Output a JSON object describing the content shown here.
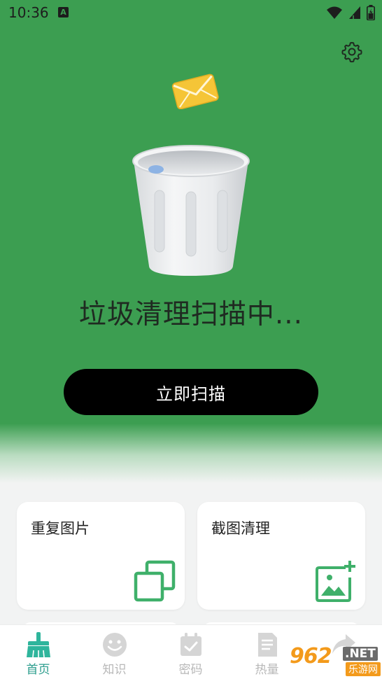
{
  "status_bar": {
    "time": "10:36",
    "notification_icon": "A",
    "icons": [
      "wifi-icon",
      "signal-icon",
      "battery-icon"
    ]
  },
  "header": {
    "settings_icon": "gear-icon"
  },
  "hero": {
    "scan_status": "垃圾清理扫描中...",
    "scan_button_label": "立即扫描",
    "background_color": "#3c9e51",
    "illustrations": [
      "envelope-icon",
      "trash-can-icon"
    ]
  },
  "cards": [
    {
      "title": "重复图片",
      "icon": "duplicate-images-icon"
    },
    {
      "title": "截图清理",
      "icon": "screenshot-clean-icon"
    }
  ],
  "tabbar": {
    "active_color": "#2a9c8c",
    "inactive_color": "#b8b8b8",
    "tabs": [
      {
        "label": "首页",
        "icon": "broom-icon",
        "active": true
      },
      {
        "label": "知识",
        "icon": "smile-icon",
        "active": false
      },
      {
        "label": "密码",
        "icon": "calendar-check-icon",
        "active": false
      },
      {
        "label": "热量",
        "icon": "document-icon",
        "active": false
      },
      {
        "label": "",
        "icon": "share-arrow-icon",
        "active": false
      }
    ]
  },
  "watermark": {
    "brand": "962",
    "suffix": ".NET",
    "subtitle": "乐游网"
  }
}
